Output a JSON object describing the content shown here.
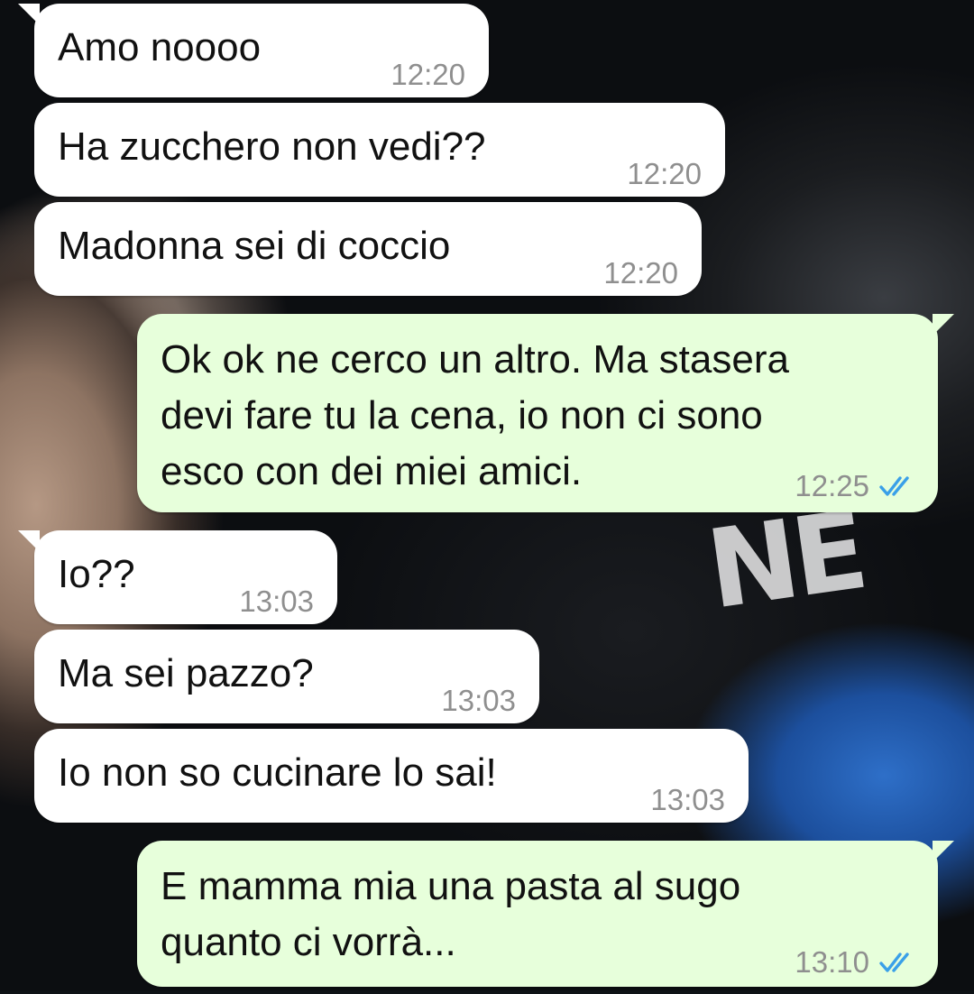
{
  "messages": [
    {
      "text": "Amo noooo",
      "time": "12:20",
      "direction": "incoming"
    },
    {
      "text": "Ha zucchero non vedi??",
      "time": "12:20",
      "direction": "incoming"
    },
    {
      "text": "Madonna sei di coccio",
      "time": "12:20",
      "direction": "incoming"
    },
    {
      "text": "Ok ok ne cerco un altro. Ma stasera\ndevi fare tu la cena, io non ci sono\nesco con dei miei amici.",
      "time": "12:25",
      "direction": "outgoing",
      "status": "read"
    },
    {
      "text": "Io??",
      "time": "13:03",
      "direction": "incoming"
    },
    {
      "text": "Ma sei pazzo?",
      "time": "13:03",
      "direction": "incoming"
    },
    {
      "text": "Io non so cucinare lo sai!",
      "time": "13:03",
      "direction": "incoming"
    },
    {
      "text": "E mamma mia una pasta al sugo\nquanto ci vorrà...",
      "time": "13:10",
      "direction": "outgoing",
      "status": "read"
    }
  ],
  "colors": {
    "incoming_bubble": "#ffffff",
    "outgoing_bubble": "#e7ffdb",
    "timestamp": "#8f8f8f",
    "read_ticks": "#3aa0e8"
  },
  "icons": {
    "read_status": "double-check-icon"
  }
}
